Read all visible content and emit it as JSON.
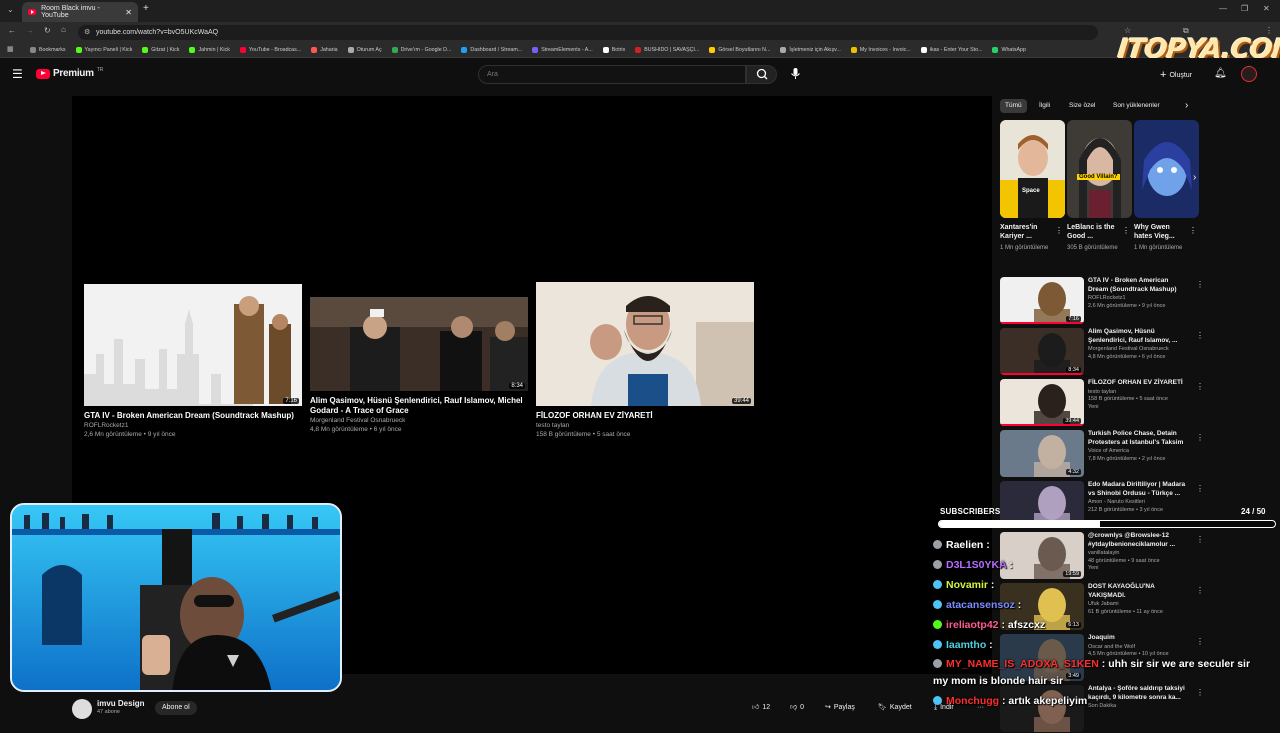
{
  "browser": {
    "tab_title": "Room Black imvu - YouTube",
    "url": "youtube.com/watch?v=bvO5UKcWaAQ",
    "new_tab": "+",
    "bookmarks": [
      {
        "label": "Bookmarks",
        "color": "#888888"
      },
      {
        "label": "Yayıncı Paneli | Kick",
        "color": "#53fc18"
      },
      {
        "label": "Gitzat | Kick",
        "color": "#53fc18"
      },
      {
        "label": "Jahmin | Kick",
        "color": "#53fc18"
      },
      {
        "label": "YouTube - Broadcas...",
        "color": "#ff0033"
      },
      {
        "label": "Jaharia",
        "color": "#ff5555"
      },
      {
        "label": "Oturum Aç",
        "color": "#aaaaaa"
      },
      {
        "label": "Drive'ım - Google D...",
        "color": "#34a853"
      },
      {
        "label": "Dashboard / Stream...",
        "color": "#1da1f2"
      },
      {
        "label": "StreamElements - A...",
        "color": "#7b5cff"
      },
      {
        "label": "Botrix",
        "color": "#ffffff"
      },
      {
        "label": "BUSHIDO | SAVAŞÇI...",
        "color": "#cc2222"
      },
      {
        "label": "Görsel Boyutlarını N...",
        "color": "#ffcc00"
      },
      {
        "label": "İşletmeniz için Akışv...",
        "color": "#aaaaaa"
      },
      {
        "label": "My Invoices - Invoic...",
        "color": "#f0c000"
      },
      {
        "label": "ikas - Enter Your Sto...",
        "color": "#ffffff"
      },
      {
        "label": "WhatsApp",
        "color": "#25d366"
      }
    ]
  },
  "header": {
    "logo_text": "Premium",
    "logo_sup": "TR",
    "search_placeholder": "Ara",
    "create_label": "Oluştur"
  },
  "endscreen": [
    {
      "title": "GTA IV - Broken American Dream (Soundtrack Mashup)",
      "channel": "ROFLRocketz1",
      "meta": "2,6 Mn görüntüleme • 9 yıl önce",
      "duration": "7:16"
    },
    {
      "title": "Alim Qasimov, Hüsnü Şenlendirici, Rauf Islamov, Michel Godard - A Trace of Grace",
      "channel": "Morgenland Festival Osnabrueck",
      "meta": "4,8 Mn görüntüleme • 6 yıl önce",
      "duration": "8:34"
    },
    {
      "title": "FİLOZOF ORHAN EV ZİYARETİ",
      "channel": "testo taylan",
      "meta": "158 B görüntüleme • 5 saat önce",
      "duration": "39:44"
    }
  ],
  "sidebar": {
    "chips": [
      "Tümü",
      "İlgili",
      "Size özel",
      "Son yüklenenler"
    ],
    "shorts": [
      {
        "title": "Xantares'in Kariyer ...",
        "views": "1 Mn görüntüleme",
        "thumb_text": "Space"
      },
      {
        "title": "LeBlanc is the Good ...",
        "views": "305 B görüntüleme",
        "thumb_text": "Good Villain?"
      },
      {
        "title": "Why Gwen hates Vieg...",
        "views": "1 Mn görüntüleme",
        "thumb_text": ""
      }
    ],
    "recommended": [
      {
        "title": "GTA IV - Broken American Dream (Soundtrack Mashup)",
        "channel": "ROFLRocketz1",
        "meta": "2,6 Mn görüntüleme • 9 yıl önce",
        "duration": "7:16",
        "badge": ""
      },
      {
        "title": "Alim Qasimov, Hüsnü Şenlendirici, Rauf Islamov, ...",
        "channel": "Morgenland Festival Osnabrueck",
        "meta": "4,8 Mn görüntüleme • 6 yıl önce",
        "duration": "8:34",
        "badge": ""
      },
      {
        "title": "FİLOZOF ORHAN EV ZİYARETİ",
        "channel": "testo taylan",
        "meta": "158 B görüntüleme • 5 saat önce",
        "duration": "39:44",
        "badge": "Yeni"
      },
      {
        "title": "Turkish Police Chase, Detain Protesters at Istanbul's Taksim",
        "channel": "Voice of America",
        "meta": "7,8 Mn görüntüleme • 2 yıl önce",
        "duration": "4:32",
        "badge": ""
      },
      {
        "title": "Edo Madara Diriltiliyor | Madara vs Shinobi Ordusu - Türkçe ...",
        "channel": "Amon - Naruto Kesitleri",
        "meta": "212 B görüntüleme • 3 yıl önce",
        "duration": "",
        "badge": ""
      },
      {
        "title": "@crownlys @Browslee-12 #ytdaylbenioneciklamolur ...",
        "channel": "vanillatalayin",
        "meta": "48 görüntüleme • 9 saat önce",
        "duration": "19:59",
        "badge": "Yeni"
      },
      {
        "title": "DOST KAYAOĞLU'NA YAKIŞMADI.",
        "channel": "Ufuk Jabami",
        "meta": "61 B görüntüleme • 11 ay önce",
        "duration": "6:13",
        "badge": ""
      },
      {
        "title": "Joaquim",
        "channel": "Oscar and the Wolf",
        "meta": "4,5 Mn görüntüleme • 10 yıl önce",
        "duration": "3:49",
        "badge": ""
      },
      {
        "title": "Antalya - Şoföre saldırıp taksiyi kaçırdı, 9 kilometre sonra ka...",
        "channel": "Son Dakika",
        "meta": "",
        "duration": "",
        "badge": ""
      }
    ]
  },
  "bottom": {
    "channel_name": "imvu Design",
    "subscribers": "47 abone",
    "subscribe_label": "Abone ol",
    "likes": "12",
    "dislikes": "0",
    "share": "Paylaş",
    "save": "Kaydet",
    "download": "İndir",
    "more": "···"
  },
  "overlay": {
    "watermark": "ITOPYA.COM",
    "subs_label": "SUBSCRIBERS",
    "subs_count": "24 / 50",
    "subs_progress": 0.48,
    "chat": [
      {
        "user": "Raelien",
        "sep": " :",
        "msg": "",
        "color": "#ffffff",
        "badge": "#9aa0a6"
      },
      {
        "user": "D3L1S0YKA",
        "sep": " :",
        "msg": "",
        "color": "#b76cff",
        "badge": "#9aa0a6"
      },
      {
        "user": "Novamir",
        "sep": " :",
        "msg": "",
        "color": "#d2f542",
        "badge": "#4fc3f7"
      },
      {
        "user": "atacansensoz",
        "sep": " :",
        "msg": "",
        "color": "#7a8cff",
        "badge": "#4fc3f7"
      },
      {
        "user": "ireliaotp42",
        "sep": " : ",
        "msg": "afszcxz",
        "color": "#ff5b8d",
        "badge": "#53fc18"
      },
      {
        "user": "Iaamtho",
        "sep": " :",
        "msg": "",
        "color": "#4dd0e1",
        "badge": "#4fc3f7"
      },
      {
        "user": "MY_NAME_IS_ADOXA_S1KEN",
        "sep": " : ",
        "msg": "uhh sir sir we are seculer sir",
        "color": "#ff2d2d",
        "badge": "#9aa0a6"
      },
      {
        "user": "",
        "sep": "",
        "msg": "my mom is blonde hair sir",
        "color": "#ffffff",
        "badge": ""
      },
      {
        "user": "Monchugg",
        "sep": " : ",
        "msg": "artık akepeliyim",
        "color": "#ff2d2d",
        "badge": "#4fc3f7"
      }
    ]
  }
}
